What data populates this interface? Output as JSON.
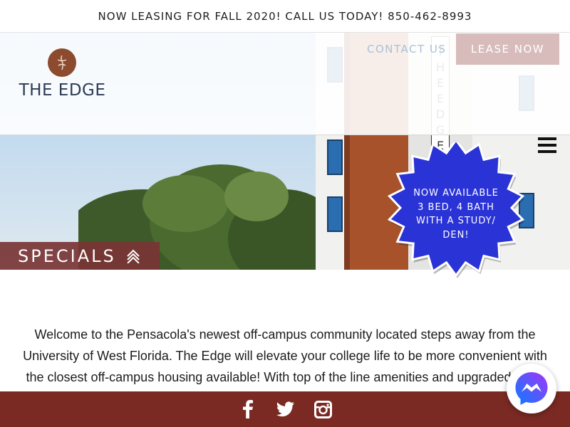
{
  "announcement": {
    "text": "NOW LEASING FOR FALL 2020! CALL US TODAY! 850-462-8993"
  },
  "header": {
    "logo_text": "THE EDGE",
    "logo_icon": "logo-emblem",
    "nav": {
      "contact_label": "CONTACT US",
      "lease_label": "LEASE NOW"
    },
    "menu_icon": "hamburger-icon"
  },
  "hero": {
    "building_sign_letters": [
      "T",
      "H",
      "E",
      "",
      "E",
      "D",
      "G",
      "E"
    ],
    "specials_label": "SPECIALS",
    "specials_icon": "double-chevron-up-icon",
    "badge": {
      "lines": [
        "NOW AVAILABLE",
        "3 BED, 4 BATH",
        "WITH A STUDY/",
        "DEN!"
      ]
    }
  },
  "content": {
    "welcome_text": "Welcome to the Pensacola's newest off-campus community located steps away from the University of West Florida. The Edge will elevate your college life to be more convenient with the closest off-campus housing available! With top of the line amenities and upgraded apart"
  },
  "footer": {
    "social": [
      "facebook-icon",
      "twitter-icon",
      "instagram-icon"
    ]
  },
  "chat_widget": {
    "icon": "messenger-icon"
  },
  "colors": {
    "brand_maroon": "#7a2a23",
    "specials_bg": "#78343a",
    "lease_button": "#d8bcbc",
    "contact_link": "#a9c1d8",
    "badge_blue": "#2a33d6",
    "logo_navy": "#2d3b55"
  }
}
